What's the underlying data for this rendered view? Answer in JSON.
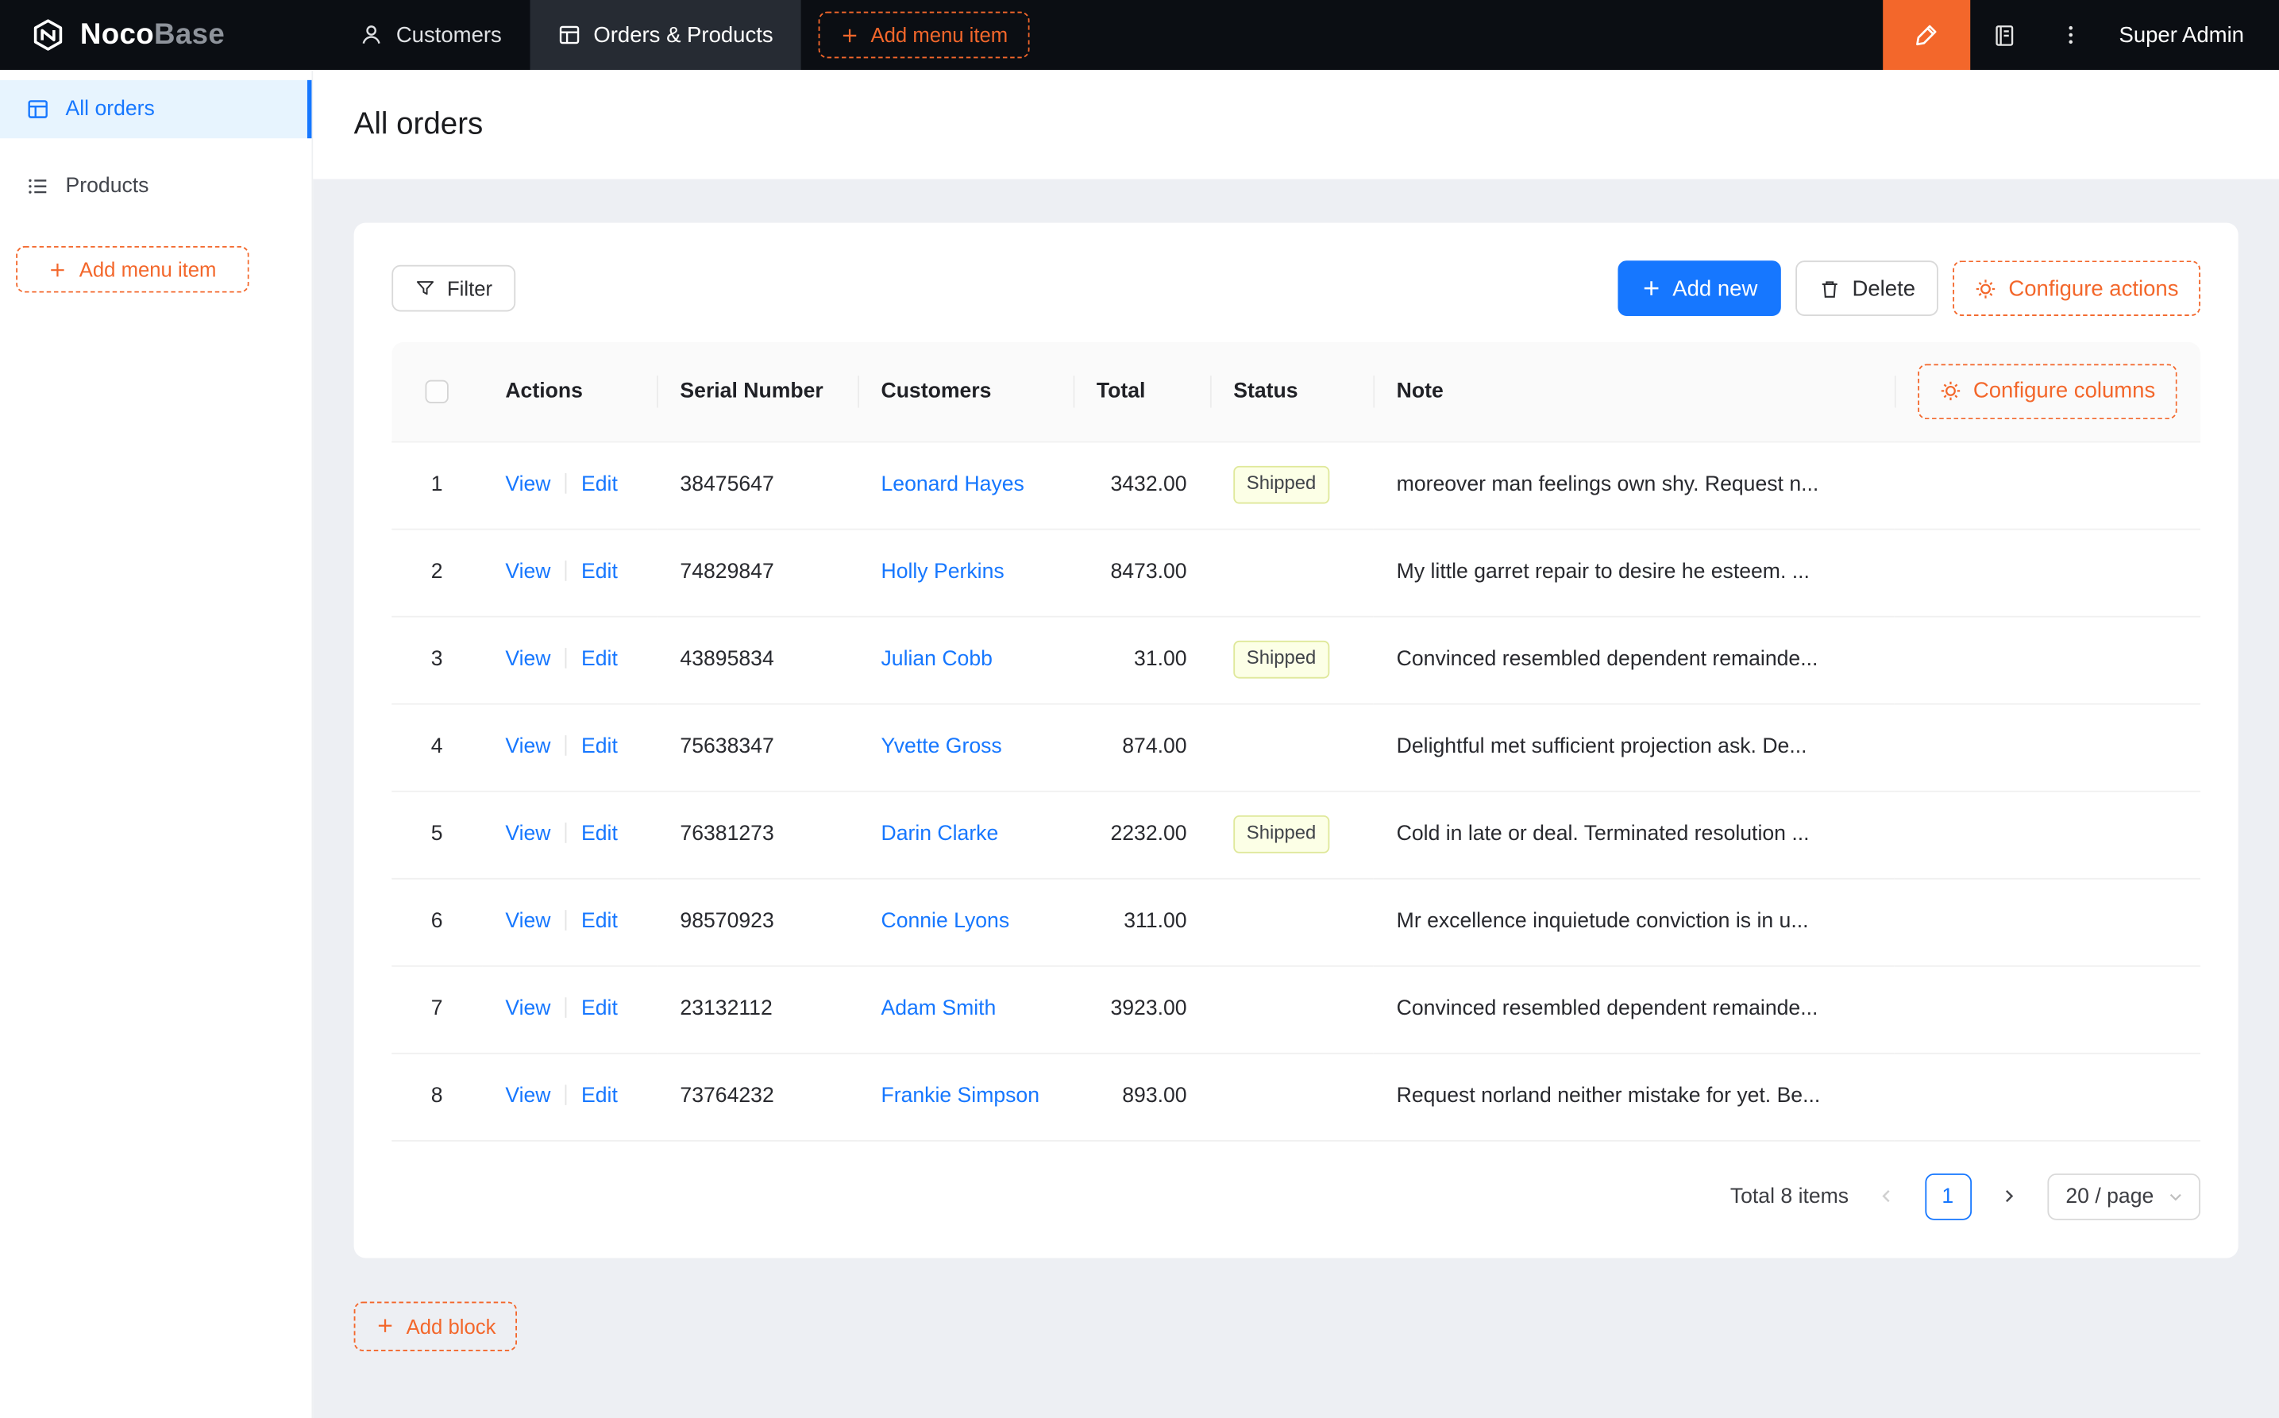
{
  "colors": {
    "accent": "#f3672b",
    "primary": "#1677ff",
    "navbar_bg": "#0b0e13",
    "sidebar_active_bg": "#e7f4fe",
    "status_shipped_bg": "#fcffe6",
    "status_shipped_border": "#dfe89a"
  },
  "navbar": {
    "logo_primary": "Noco",
    "logo_secondary": "Base",
    "items": [
      {
        "label": "Customers"
      },
      {
        "label": "Orders & Products"
      }
    ],
    "add_menu_item": "Add menu item",
    "user": "Super Admin"
  },
  "sidebar": {
    "items": [
      {
        "label": "All orders"
      },
      {
        "label": "Products"
      }
    ],
    "add_menu_item": "Add menu item"
  },
  "page": {
    "title": "All orders"
  },
  "toolbar": {
    "filter": "Filter",
    "add_new": "Add new",
    "delete": "Delete",
    "configure_actions": "Configure actions"
  },
  "table": {
    "columns": [
      "Actions",
      "Serial Number",
      "Customers",
      "Total",
      "Status",
      "Note"
    ],
    "configure_columns": "Configure columns",
    "action_links": {
      "view": "View",
      "edit": "Edit"
    },
    "rows": [
      {
        "index": "1",
        "serial": "38475647",
        "customer": "Leonard Hayes",
        "total": "3432.00",
        "status": "Shipped",
        "note": "moreover man feelings own shy. Request n..."
      },
      {
        "index": "2",
        "serial": "74829847",
        "customer": "Holly Perkins",
        "total": "8473.00",
        "note": "My little garret repair to desire he esteem. ..."
      },
      {
        "index": "3",
        "serial": "43895834",
        "customer": "Julian Cobb",
        "total": "31.00",
        "status": "Shipped",
        "note": "Convinced resembled dependent remainde..."
      },
      {
        "index": "4",
        "serial": "75638347",
        "customer": "Yvette Gross",
        "total": "874.00",
        "note": "Delightful met sufficient projection ask. De..."
      },
      {
        "index": "5",
        "serial": "76381273",
        "customer": "Darin Clarke",
        "total": "2232.00",
        "status": "Shipped",
        "note": "Cold in late or deal. Terminated resolution ..."
      },
      {
        "index": "6",
        "serial": "98570923",
        "customer": "Connie Lyons",
        "total": "311.00",
        "note": "Mr excellence inquietude conviction is in u..."
      },
      {
        "index": "7",
        "serial": "23132112",
        "customer": "Adam Smith",
        "total": "3923.00",
        "note": "Convinced resembled dependent remainde..."
      },
      {
        "index": "8",
        "serial": "73764232",
        "customer": "Frankie Simpson",
        "total": "893.00",
        "note": "Request norland neither mistake for yet. Be..."
      }
    ]
  },
  "pagination": {
    "total_label": "Total 8 items",
    "current_page": "1",
    "page_size": "20 / page"
  },
  "footer": {
    "add_block": "Add block"
  }
}
